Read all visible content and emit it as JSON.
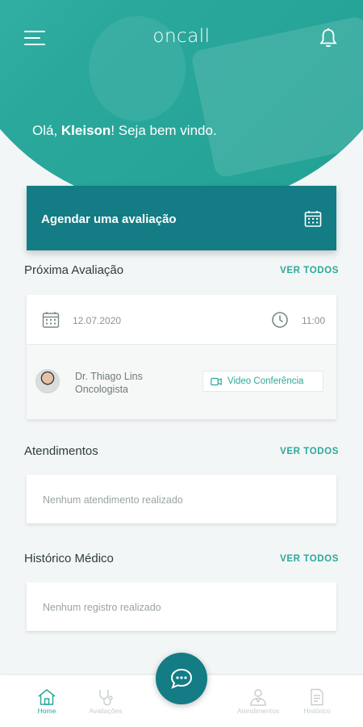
{
  "app": {
    "logo": "oncall"
  },
  "greeting": {
    "prefix": "Olá, ",
    "name": "Kleison",
    "suffix": "! Seja bem vindo."
  },
  "schedule_button": {
    "label": "Agendar uma avaliação",
    "icon": "calendar-icon"
  },
  "next_appointment": {
    "title": "Próxima Avaliação",
    "see_all": "VER TODOS",
    "date": "12.07.2020",
    "time": "11:00",
    "doctor_name": "Dr. Thiago Lins",
    "doctor_specialty": "Oncologista",
    "video_button": "Video Conferência"
  },
  "attendances": {
    "title": "Atendimentos",
    "see_all": "VER TODOS",
    "empty_text": "Nenhum atendimento realizado"
  },
  "medical_history": {
    "title": "Histórico Médico",
    "see_all": "VER TODOS",
    "empty_text": "Nenhum registro realizado"
  },
  "bottom_nav": {
    "items": [
      {
        "label": "Home",
        "icon": "home-icon",
        "active": true
      },
      {
        "label": "Avaliações",
        "icon": "stethoscope-icon",
        "active": false
      },
      {
        "label": "Atendimentos",
        "icon": "doctor-icon",
        "active": false
      },
      {
        "label": "Histórico",
        "icon": "document-icon",
        "active": false
      }
    ],
    "fab_icon": "chat-icon"
  },
  "colors": {
    "primary": "#2ba89a",
    "dark_primary": "#137c85",
    "background": "#f2f6f6"
  }
}
